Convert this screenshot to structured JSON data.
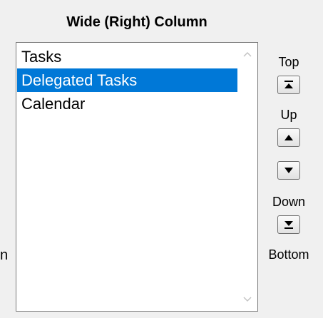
{
  "panel": {
    "title": "Wide (Right) Column",
    "stray_text": "n"
  },
  "list": {
    "items": [
      {
        "label": "Tasks",
        "selected": false
      },
      {
        "label": "Delegated Tasks",
        "selected": true
      },
      {
        "label": "Calendar",
        "selected": false
      }
    ],
    "selection_color": "#0078d7"
  },
  "scrollbar": {
    "up_icon": "chevron-up-icon",
    "down_icon": "chevron-down-icon"
  },
  "controls": {
    "top_label": "Top",
    "up_label": "Up",
    "down_label": "Down",
    "bottom_label": "Bottom",
    "top_icon": "move-to-top-icon",
    "up_icon": "triangle-up-icon",
    "down_icon": "triangle-down-icon",
    "bottom_icon": "move-to-bottom-icon"
  }
}
